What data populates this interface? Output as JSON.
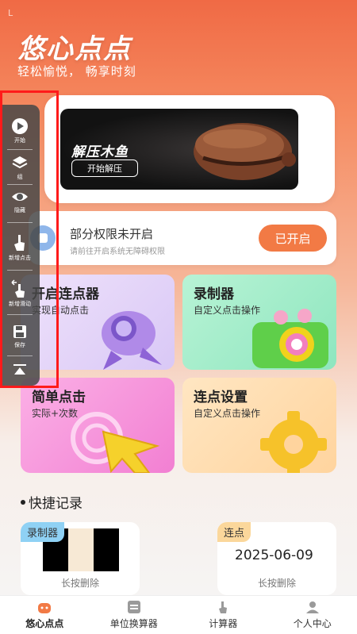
{
  "header": {
    "status_mark": "L",
    "title": "悠心点点",
    "subtitle": "轻松愉悦， 畅享时刻"
  },
  "banner": {
    "title": "解压木鱼",
    "button": "开始解压"
  },
  "permission": {
    "title": "部分权限未开启",
    "description": "请前往开启系统无障碍权限",
    "button": "已开启"
  },
  "cards": [
    {
      "title": "开启连点器",
      "subtitle": "实现自动点击"
    },
    {
      "title": "录制器",
      "subtitle": "自定义点击操作"
    },
    {
      "title": "简单点击",
      "subtitle": "实际+次数"
    },
    {
      "title": "连点设置",
      "subtitle": "自定义点击操作"
    }
  ],
  "quick_records": {
    "title": "快捷记录",
    "items": [
      {
        "tag": "录制器",
        "hint": "长按删除"
      },
      {
        "tag": "连点",
        "date": "2025-06-09",
        "hint": "长按删除"
      }
    ]
  },
  "float_toolbar": {
    "items": [
      {
        "label": "开始",
        "icon": "play-icon"
      },
      {
        "label": "组",
        "icon": "layers-icon"
      },
      {
        "label": "隐藏",
        "icon": "eye-icon"
      },
      {
        "label": "新增点击",
        "icon": "tap-icon"
      },
      {
        "label": "新增滑动",
        "icon": "swipe-icon"
      },
      {
        "label": "保存",
        "icon": "save-icon"
      },
      {
        "label": "",
        "icon": "collapse-top-icon"
      }
    ]
  },
  "bottom_nav": {
    "items": [
      {
        "label": "悠心点点",
        "icon": "home-icon",
        "active": true
      },
      {
        "label": "单位换算器",
        "icon": "converter-icon"
      },
      {
        "label": "计算器",
        "icon": "calculator-icon"
      },
      {
        "label": "个人中心",
        "icon": "profile-icon"
      }
    ]
  },
  "colors": {
    "accent": "#f27a45",
    "highlight": "#ff1a1a"
  }
}
